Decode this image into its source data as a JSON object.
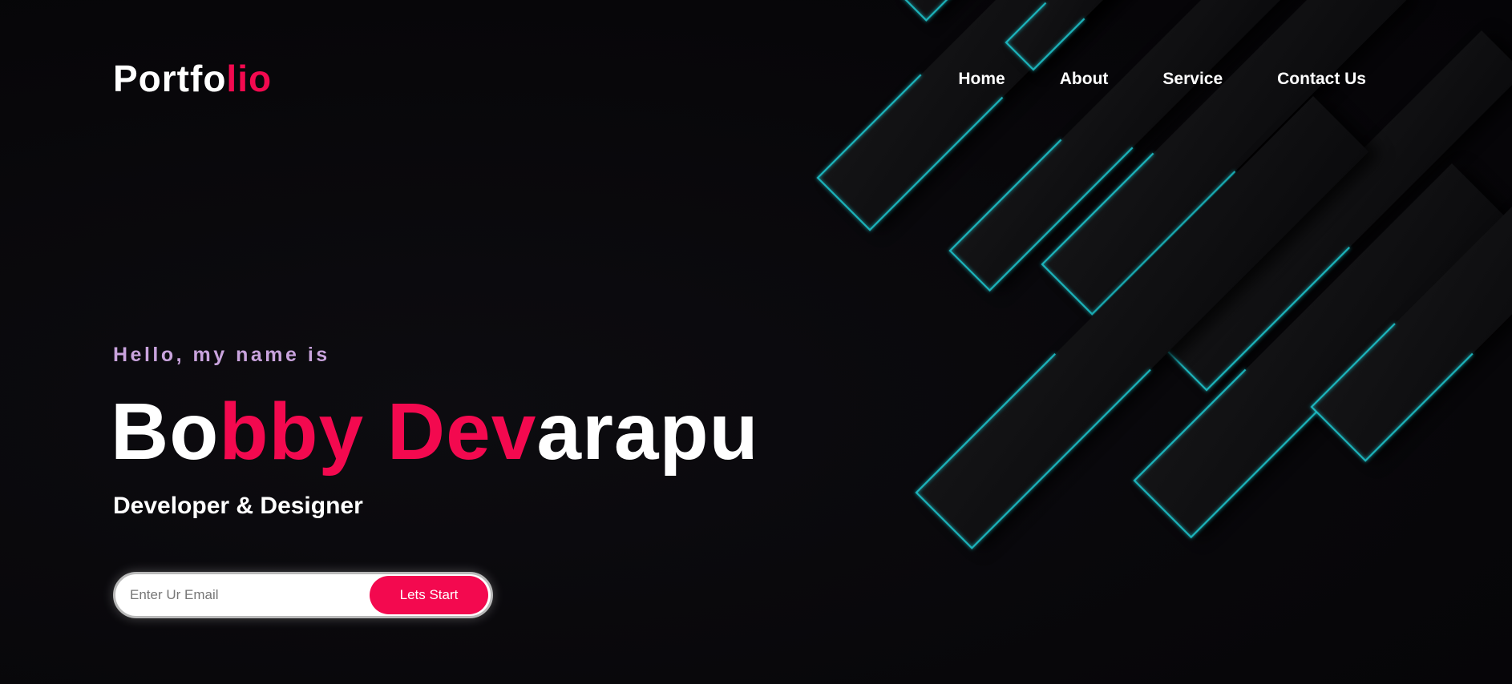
{
  "logo": {
    "part1": "Portfo",
    "part2": "lio"
  },
  "nav": {
    "items": [
      {
        "label": "Home"
      },
      {
        "label": "About"
      },
      {
        "label": "Service"
      },
      {
        "label": "Contact Us"
      }
    ]
  },
  "hero": {
    "greeting": "Hello, my name is",
    "name_part1": "Bo",
    "name_part2": "bby Dev",
    "name_part3": "arapu",
    "role": "Developer & Designer"
  },
  "signup": {
    "email_placeholder": "Enter Ur Email",
    "email_value": "",
    "button_label": "Lets Start"
  },
  "colors": {
    "accent": "#f3094f",
    "background": "#08070a",
    "greeting": "#c9a3dd",
    "neon": "#20c7cf"
  }
}
